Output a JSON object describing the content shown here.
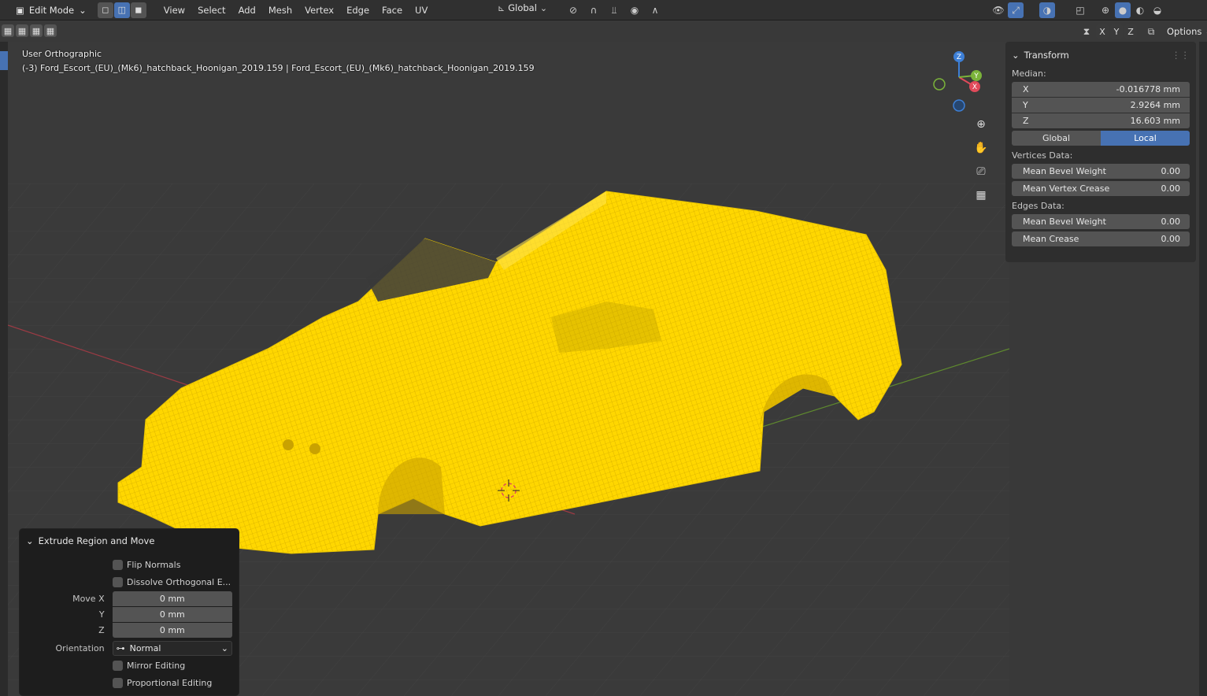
{
  "header": {
    "mode": "Edit Mode",
    "menus": [
      "View",
      "Select",
      "Add",
      "Mesh",
      "Vertex",
      "Edge",
      "Face",
      "UV"
    ],
    "transform_orientation": "Global",
    "options_label": "Options",
    "axis_x": "X",
    "axis_y": "Y",
    "axis_z": "Z"
  },
  "viewport": {
    "view_name": "User Orthographic",
    "object_info": "(-3) Ford_Escort_(EU)_(Mk6)_hatchback_Hoonigan_2019.159 | Ford_Escort_(EU)_(Mk6)_hatchback_Hoonigan_2019.159",
    "gizmo": {
      "x": "X",
      "y": "Y",
      "z": "Z"
    },
    "mesh_color": "#ffd700",
    "background_color": "#3a3a3a"
  },
  "npanel": {
    "title": "Transform",
    "median_label": "Median:",
    "median": [
      {
        "axis": "X",
        "value": "-0.016778 mm"
      },
      {
        "axis": "Y",
        "value": "2.9264 mm"
      },
      {
        "axis": "Z",
        "value": "16.603 mm"
      }
    ],
    "space_global": "Global",
    "space_local": "Local",
    "vertices_label": "Vertices Data:",
    "vertices": [
      {
        "label": "Mean Bevel Weight",
        "value": "0.00"
      },
      {
        "label": "Mean Vertex Crease",
        "value": "0.00"
      }
    ],
    "edges_label": "Edges Data:",
    "edges": [
      {
        "label": "Mean Bevel Weight",
        "value": "0.00"
      },
      {
        "label": "Mean Crease",
        "value": "0.00"
      }
    ]
  },
  "redo_panel": {
    "title": "Extrude Region and Move",
    "flip_normals": "Flip Normals",
    "dissolve": "Dissolve Orthogonal E...",
    "move_x_label": "Move X",
    "move_y_label": "Y",
    "move_z_label": "Z",
    "move_x": "0 mm",
    "move_y": "0 mm",
    "move_z": "0 mm",
    "orientation_label": "Orientation",
    "orientation": "Normal",
    "mirror_editing": "Mirror Editing",
    "proportional_editing": "Proportional Editing"
  },
  "colors": {
    "accent": "#4772b3",
    "axis_x": "#e04a5a",
    "axis_y": "#7bb33a",
    "axis_z": "#3d7fd6"
  }
}
